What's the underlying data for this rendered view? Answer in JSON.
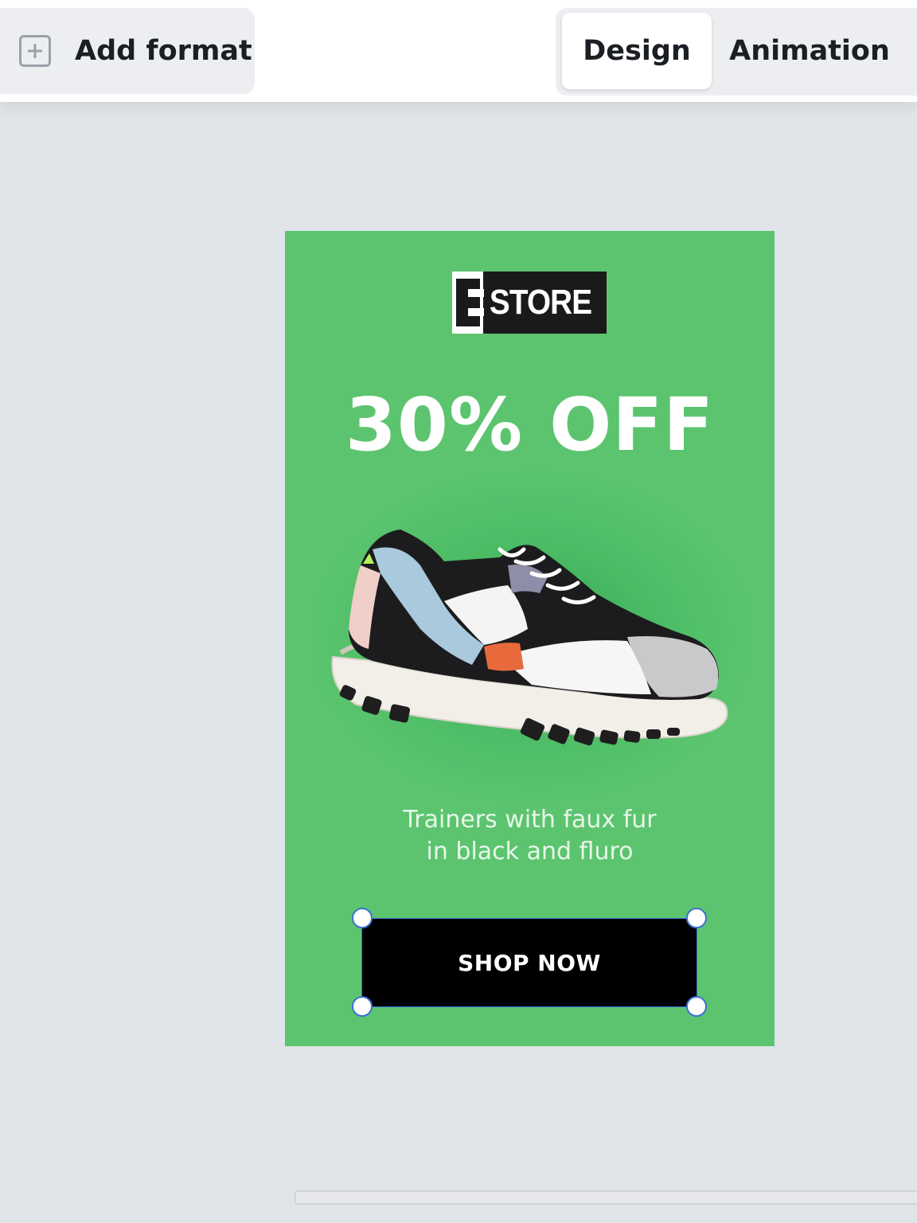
{
  "toolbar": {
    "add_format_label": "Add format",
    "add_format_icon": "plus-square-icon",
    "tabs": [
      {
        "label": "Design",
        "active": true
      },
      {
        "label": "Animation",
        "active": false
      }
    ]
  },
  "ad": {
    "background_color": "#5cc46f",
    "logo": {
      "letter": "E",
      "text": "STORE"
    },
    "headline": "30% OFF",
    "product_image": "sneaker-image",
    "subtitle_lines": [
      "Trainers with faux fur",
      "in black and fluro"
    ],
    "cta_label": "SHOP NOW",
    "cta_selected": true
  },
  "colors": {
    "selection": "#3b6fd6",
    "canvas_bg": "#e1e4e8"
  }
}
